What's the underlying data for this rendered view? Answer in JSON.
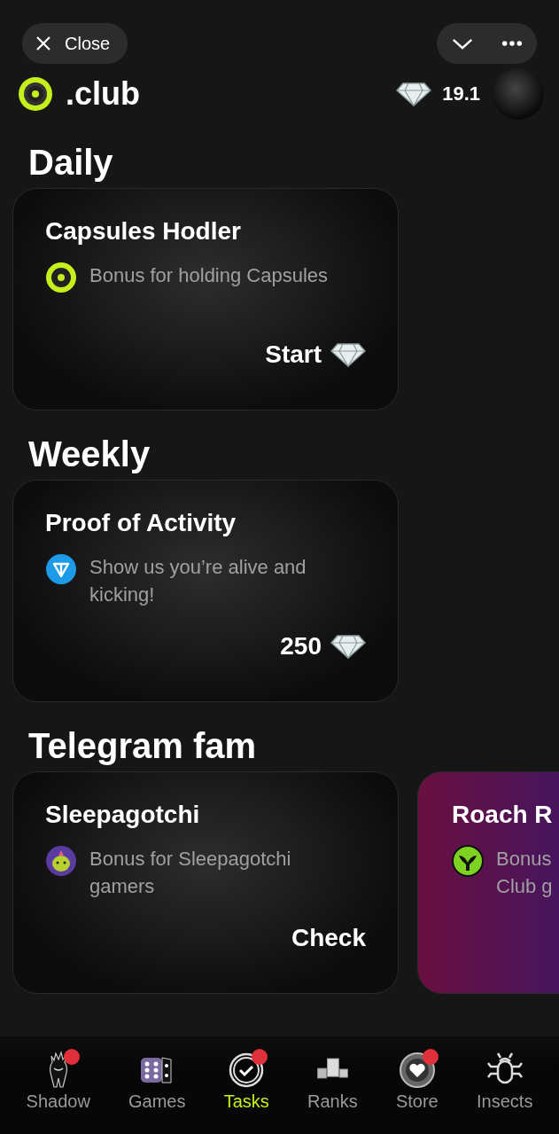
{
  "top_bar": {
    "close_label": "Close"
  },
  "header": {
    "brand": ".club",
    "balance": "19.1"
  },
  "sections": [
    {
      "title": "Daily",
      "cards": [
        {
          "title": "Capsules Hodler",
          "kind": "club",
          "description": "Bonus for holding Capsules",
          "action": {
            "label": "Start",
            "diamond": true
          }
        }
      ]
    },
    {
      "title": "Weekly",
      "cards": [
        {
          "title": "Proof of Activity",
          "kind": "ton",
          "description": "Show us you’re alive and kicking!",
          "action": {
            "label": "250",
            "diamond": true
          }
        }
      ]
    },
    {
      "title": "Telegram fam",
      "cards": [
        {
          "title": "Sleepagotchi",
          "kind": "sleepagotchi",
          "description": "Bonus for Sleepagotchi gamers",
          "action": {
            "label": "Check",
            "diamond": false
          }
        },
        {
          "title": "Roach R",
          "kind": "alien",
          "description": "Bonus",
          "extra_line": "Club g"
        }
      ]
    }
  ],
  "nav": [
    {
      "label": "Shadow",
      "kind": "shadow",
      "selected": false,
      "badge": true
    },
    {
      "label": "Games",
      "kind": "dice",
      "selected": false,
      "badge": false
    },
    {
      "label": "Tasks",
      "kind": "check",
      "selected": true,
      "badge": true
    },
    {
      "label": "Ranks",
      "kind": "cubes",
      "selected": false,
      "badge": false
    },
    {
      "label": "Store",
      "kind": "heart",
      "selected": false,
      "badge": true
    },
    {
      "label": "Insects",
      "kind": "bug",
      "selected": false,
      "badge": false
    }
  ]
}
